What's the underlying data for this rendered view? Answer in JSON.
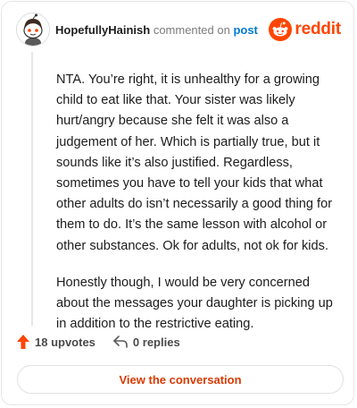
{
  "header": {
    "username": "HopefullyHainish",
    "commented_on": "commented on",
    "post_link": "post",
    "avatar_icon": "snoo-avatar-icon"
  },
  "brand": {
    "icon": "reddit-snoo-icon",
    "wordmark": "reddit",
    "color": "#ff4500"
  },
  "comment": {
    "paragraphs": [
      "NTA. You’re right, it is unhealthy for a growing child to eat like that. Your sister was likely hurt/angry because she felt it was also a judgement of her. Which is partially true, but it sounds like it’s also justified. Regardless, sometimes you have to tell your kids that what other adults do isn’t necessarily a good thing for them to do. It’s the same lesson with alcohol or other substances. Ok for adults, not ok for kids.",
      "Honestly though, I would be very concerned about the messages your daughter is picking up in addition to the restrictive eating."
    ]
  },
  "actions": {
    "upvotes": "18 upvotes",
    "upvote_icon": "upvote-arrow-icon",
    "upvote_color": "#ff4500",
    "replies": "0 replies",
    "reply_icon": "reply-arrow-icon"
  },
  "cta": {
    "label": "View the conversation",
    "color": "#d93a00"
  }
}
